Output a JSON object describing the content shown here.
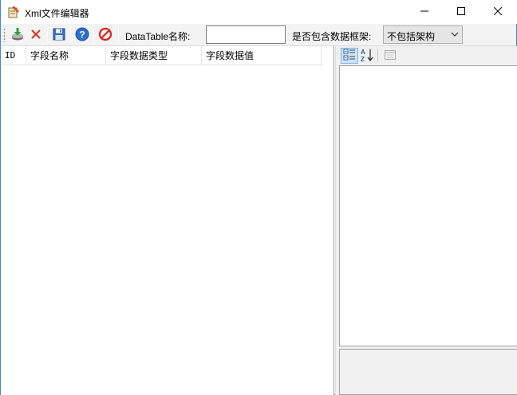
{
  "window": {
    "title": "Xml文件编辑器",
    "app_icon": "xml-editor-icon"
  },
  "window_controls": {
    "minimize_icon": "minimize-icon",
    "maximize_icon": "maximize-icon",
    "close_icon": "close-icon"
  },
  "toolbar": {
    "buttons": [
      {
        "name": "import",
        "icon": "download-icon"
      },
      {
        "name": "delete",
        "icon": "delete-x-icon"
      },
      {
        "name": "save",
        "icon": "save-icon"
      },
      {
        "name": "help",
        "icon": "help-icon"
      },
      {
        "name": "stop",
        "icon": "stop-icon"
      }
    ],
    "datatable_label": "DataTable名称:",
    "datatable_value": "",
    "schema_label": "是否包含数据框架:",
    "schema_selected": "不包括架构"
  },
  "grid": {
    "columns": [
      "ID",
      "字段名称",
      "字段数据类型",
      "字段数据值"
    ],
    "rows": []
  },
  "property_grid": {
    "toolbar": [
      {
        "name": "categorized",
        "icon": "categorized-icon",
        "active": true
      },
      {
        "name": "alphabetical",
        "icon": "sort-az-icon",
        "active": false
      },
      {
        "name": "property-pages",
        "icon": "property-pages-icon",
        "active": false
      }
    ]
  },
  "colors": {
    "window_border": "#3c8bd9",
    "toolbar_bg": "#f3f3f3",
    "panel_bg": "#f0f0f0",
    "delete_red": "#d93025",
    "stop_red": "#e0201b",
    "help_blue": "#2a6fd1"
  }
}
